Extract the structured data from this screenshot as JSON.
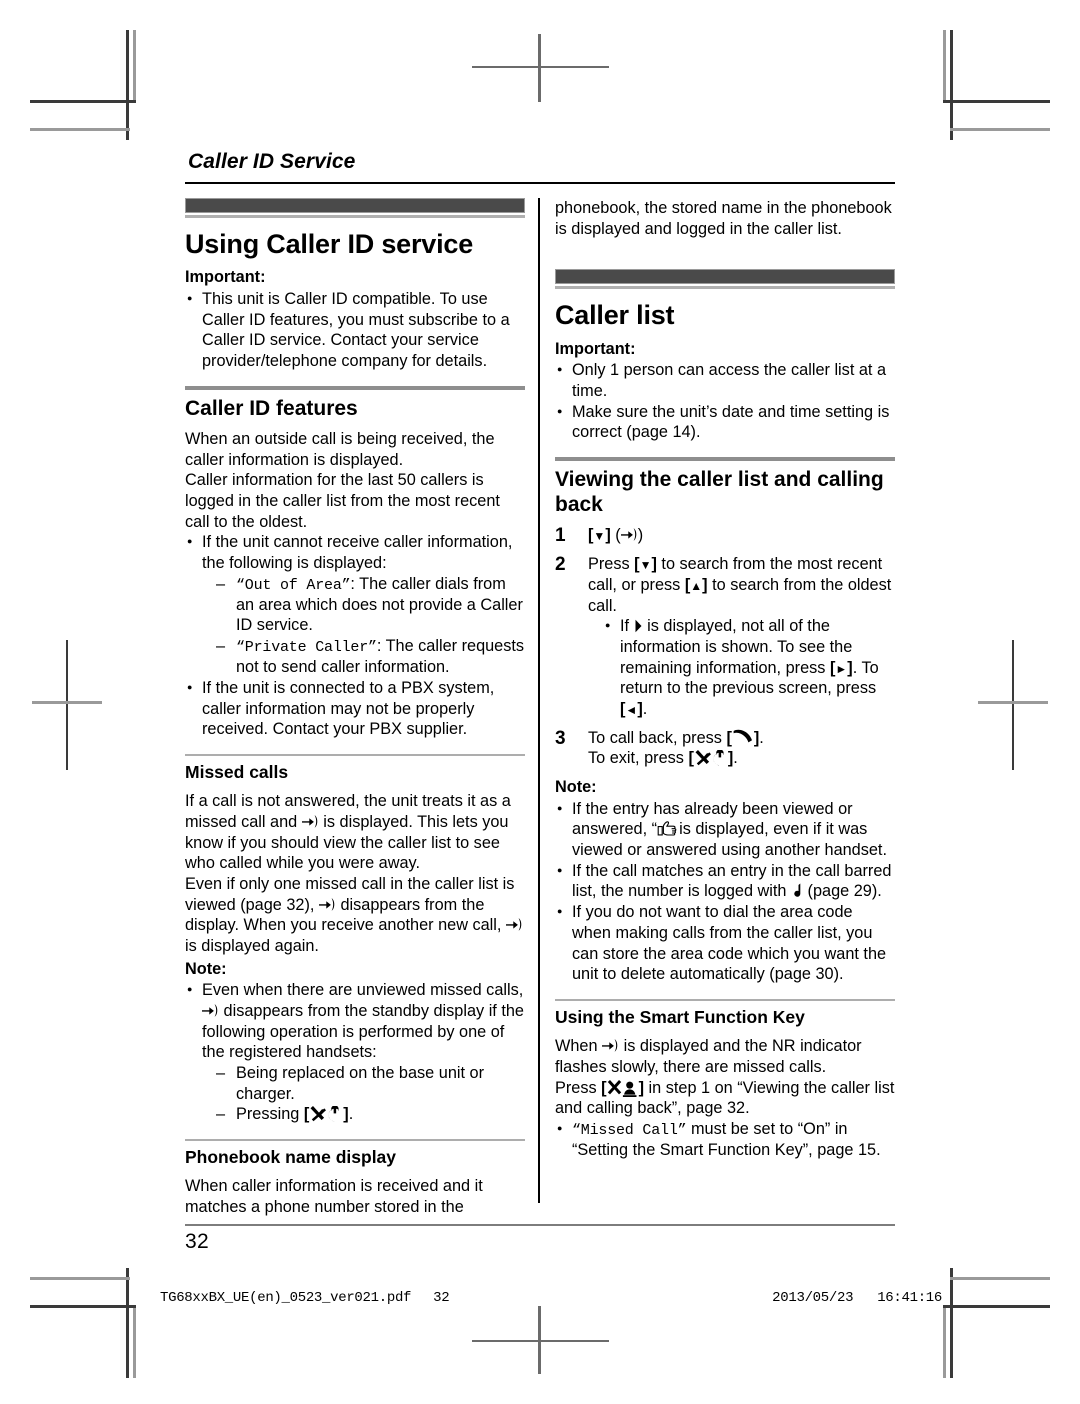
{
  "running_head": "Caller ID Service",
  "left_column": {
    "chapter_title": "Using Caller ID service",
    "important_label": "Important:",
    "important_bullets": [
      "This unit is Caller ID compatible. To use Caller ID features, you must subscribe to a Caller ID service. Contact your service provider/telephone company for details."
    ],
    "caller_id_features": {
      "heading": "Caller ID features",
      "para1": "When an outside call is being received, the caller information is displayed.",
      "para2": "Caller information for the last 50 callers is logged in the caller list from the most recent call to the oldest.",
      "bullet1_intro": "If the unit cannot receive caller information, the following is displayed:",
      "dash1_code": "“Out of Area”",
      "dash1_text": ": The caller dials from an area which does not provide a Caller ID service.",
      "dash2_code": "“Private Caller”",
      "dash2_text": ": The caller requests not to send caller information.",
      "bullet2": "If the unit is connected to a PBX system, caller information may not be properly received. Contact your PBX supplier."
    },
    "missed_calls": {
      "heading": "Missed calls",
      "para1_a": "If a call is not answered, the unit treats it as a missed call and ",
      "para1_b": " is displayed. This lets you know if you should view the caller list to see who called while you were away.",
      "para2_a": "Even if only one missed call in the caller list is viewed (page 32), ",
      "para2_b": " disappears from the display. When you receive another new call, ",
      "para2_c": " is displayed again.",
      "note_label": "Note:",
      "note_bullet_a": "Even when there are unviewed missed calls, ",
      "note_bullet_b": " disappears from the standby display if the following operation is performed by one of the registered handsets:",
      "note_dash1": "Being replaced on the base unit or charger.",
      "note_dash2_a": "Pressing ",
      "note_dash2_b": "."
    },
    "phonebook_name_display": {
      "heading": "Phonebook name display",
      "para": "When caller information is received and it matches a phone number stored in the"
    }
  },
  "right_column": {
    "continued_para": "phonebook, the stored name in the phonebook is displayed and logged in the caller list.",
    "chapter_title": "Caller list",
    "important_label": "Important:",
    "important_bullets": [
      "Only 1 person can access the caller list at a time.",
      "Make sure the unit’s date and time setting is correct (page 14)."
    ],
    "viewing": {
      "heading": "Viewing the caller list and calling back",
      "step1_num": "1",
      "step2_num": "2",
      "step3_num": "3",
      "step2_text_a": "Press ",
      "step2_key_down": "[▼]",
      "step2_text_b": " to search from the most recent call, or press ",
      "step2_key_up": "[▲]",
      "step2_text_c": " to search from the oldest call.",
      "step2_bullet_a": "If ",
      "step2_bullet_b": " is displayed, not all of the information is shown. To see the remaining information, press ",
      "step2_bullet_key_right": "[►]",
      "step2_bullet_c": ". To return to the previous screen, press ",
      "step2_bullet_key_left": "[◄]",
      "step2_bullet_d": ".",
      "step3_text_a": "To call back, press ",
      "step3_text_b": ".",
      "step3_text_c": "To exit, press ",
      "step3_text_d": ".",
      "note_label": "Note:",
      "note1_a": "If the entry has already been viewed or answered, “",
      "note1_b": "is displayed, even if it was viewed or answered using another handset.",
      "note2_a": "If the call matches an entry in the call barred list, the number is logged with ",
      "note2_b": " (page 29).",
      "note3": "If you do not want to dial the area code when making calls from the caller list, you can store the area code which you want the unit to delete automatically (page 30)."
    },
    "smart_function_key": {
      "heading": "Using the Smart Function Key",
      "para1_a": "When ",
      "para1_b": " is displayed and the NR indicator flashes slowly, there are missed calls.",
      "para2_a": "Press ",
      "para2_b": " in step 1 on “Viewing the caller list and calling back”, page 32.",
      "bullet_code": "“Missed Call”",
      "bullet_text": " must be set to “On” in “Setting the Smart Function Key”, page 15."
    }
  },
  "folio": "32",
  "sheet_info": {
    "filename": "TG68xxBX_UE(en)_0523_ver021.pdf",
    "page": "32",
    "date": "2013/05/23",
    "time": "16:41:16"
  },
  "icons": {
    "missed_call": "missed-call-icon",
    "power_off": "phone-off-icon",
    "talk": "talk-handset-icon",
    "viewed_hand": "pointing-hand-icon",
    "music_note": "music-note-icon",
    "smart_function": "smart-function-key-icon",
    "right_caret": "right-caret-icon"
  },
  "colors": {
    "chapter_bar": "#4a4a4a",
    "section_rule": "#8e8e8e",
    "sub_rule": "#adadad",
    "crop_mark": "#6b6b6b"
  }
}
